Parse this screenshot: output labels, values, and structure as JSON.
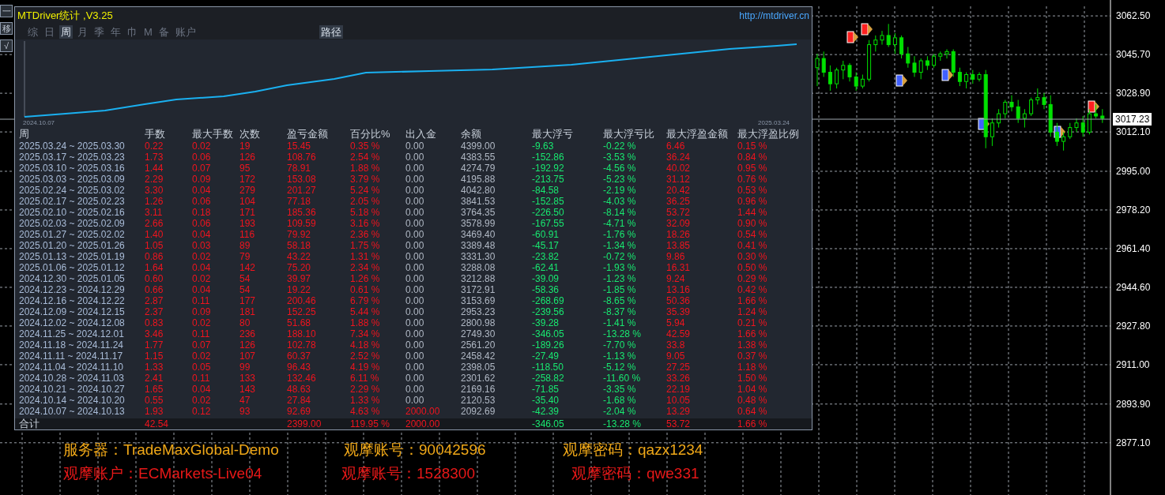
{
  "toolbar": [
    "一",
    "移",
    "√"
  ],
  "panel": {
    "title": "MTDriver统计 ,V3.25",
    "link": "http://mtdriver.cn",
    "tabs": [
      {
        "label": "综",
        "selected": false
      },
      {
        "label": "日",
        "selected": false
      },
      {
        "label": "周",
        "selected": true
      },
      {
        "label": "月",
        "selected": false
      },
      {
        "label": "季",
        "selected": false
      },
      {
        "label": "年",
        "selected": false
      },
      {
        "label": "巾",
        "selected": false
      },
      {
        "label": "M",
        "selected": false
      },
      {
        "label": "备",
        "selected": false
      },
      {
        "label": "账户",
        "selected": false
      }
    ],
    "path_button": "路径",
    "equity_chart": {
      "start_label": "2024.10.07",
      "end_label": "2025.03.24"
    },
    "table": {
      "columns": [
        {
          "label": "周",
          "kind": "date"
        },
        {
          "label": "手数",
          "kind": "red"
        },
        {
          "label": "最大手数",
          "kind": "red"
        },
        {
          "label": "次数",
          "kind": "red"
        },
        {
          "label": "盈亏金额",
          "kind": "red"
        },
        {
          "label": "百分比%",
          "kind": "red"
        },
        {
          "label": "出入金",
          "kind": "deposit"
        },
        {
          "label": "余额",
          "kind": "neutral"
        },
        {
          "label": "最大浮亏",
          "kind": "green"
        },
        {
          "label": "最大浮亏比",
          "kind": "green"
        },
        {
          "label": "最大浮盈金额",
          "kind": "red"
        },
        {
          "label": "最大浮盈比例",
          "kind": "red"
        }
      ],
      "rows": [
        {
          "flagged": false,
          "cells": [
            "2025.03.24 ~ 2025.03.30",
            "0.22",
            "0.02",
            "19",
            "15.45",
            "0.35 %",
            "0.00",
            "4399.00",
            "-9.63",
            "-0.22 %",
            "6.46",
            "0.15 %"
          ]
        },
        {
          "flagged": false,
          "cells": [
            "2025.03.17 ~ 2025.03.23",
            "1.73",
            "0.06",
            "126",
            "108.76",
            "2.54 %",
            "0.00",
            "4383.55",
            "-152.86",
            "-3.53 %",
            "36.24",
            "0.84 %"
          ]
        },
        {
          "flagged": false,
          "cells": [
            "2025.03.10 ~ 2025.03.16",
            "1.44",
            "0.07",
            "95",
            "78.91",
            "1.88 %",
            "0.00",
            "4274.79",
            "-192.92",
            "-4.56 %",
            "40.02",
            "0.95 %"
          ]
        },
        {
          "flagged": false,
          "cells": [
            "2025.03.03 ~ 2025.03.09",
            "2.29",
            "0.09",
            "172",
            "153.08",
            "3.79 %",
            "0.00",
            "4195.88",
            "-213.75",
            "-5.23 %",
            "31.12",
            "0.76 %"
          ]
        },
        {
          "flagged": false,
          "cells": [
            "2025.02.24 ~ 2025.03.02",
            "3.30",
            "0.04",
            "279",
            "201.27",
            "5.24 %",
            "0.00",
            "4042.80",
            "-84.58",
            "-2.19 %",
            "20.42",
            "0.53 %"
          ]
        },
        {
          "flagged": false,
          "cells": [
            "2025.02.17 ~ 2025.02.23",
            "1.26",
            "0.06",
            "104",
            "77.18",
            "2.05 %",
            "0.00",
            "3841.53",
            "-152.85",
            "-4.03 %",
            "36.25",
            "0.96 %"
          ]
        },
        {
          "flagged": false,
          "cells": [
            "2025.02.10 ~ 2025.02.16",
            "3.11",
            "0.18",
            "171",
            "185.36",
            "5.18 %",
            "0.00",
            "3764.35",
            "-226.50",
            "-8.14 %",
            "53.72",
            "1.44 %"
          ]
        },
        {
          "flagged": false,
          "cells": [
            "2025.02.03 ~ 2025.02.09",
            "2.66",
            "0.06",
            "193",
            "109.59",
            "3.16 %",
            "0.00",
            "3578.99",
            "-167.55",
            "-4.71 %",
            "32.09",
            "0.90 %"
          ]
        },
        {
          "flagged": false,
          "cells": [
            "2025.01.27 ~ 2025.02.02",
            "1.40",
            "0.04",
            "116",
            "79.92",
            "2.36 %",
            "0.00",
            "3469.40",
            "-60.91",
            "-1.76 %",
            "18.26",
            "0.54 %"
          ]
        },
        {
          "flagged": false,
          "cells": [
            "2025.01.20 ~ 2025.01.26",
            "1.05",
            "0.03",
            "89",
            "58.18",
            "1.75 %",
            "0.00",
            "3389.48",
            "-45.17",
            "-1.34 %",
            "13.85",
            "0.41 %"
          ]
        },
        {
          "flagged": false,
          "cells": [
            "2025.01.13 ~ 2025.01.19",
            "0.86",
            "0.02",
            "79",
            "43.22",
            "1.31 %",
            "0.00",
            "3331.30",
            "-23.82",
            "-0.72 %",
            "9.86",
            "0.30 %"
          ]
        },
        {
          "flagged": false,
          "cells": [
            "2025.01.06 ~ 2025.01.12",
            "1.64",
            "0.04",
            "142",
            "75.20",
            "2.34 %",
            "0.00",
            "3288.08",
            "-62.41",
            "-1.93 %",
            "16.31",
            "0.50 %"
          ]
        },
        {
          "flagged": false,
          "cells": [
            "2024.12.30 ~ 2025.01.05",
            "0.60",
            "0.02",
            "54",
            "39.97",
            "1.26 %",
            "0.00",
            "3212.88",
            "-39.09",
            "-1.23 %",
            "9.24",
            "0.29 %"
          ]
        },
        {
          "flagged": false,
          "cells": [
            "2024.12.23 ~ 2024.12.29",
            "0.66",
            "0.04",
            "54",
            "19.22",
            "0.61 %",
            "0.00",
            "3172.91",
            "-58.36",
            "-1.85 %",
            "13.16",
            "0.42 %"
          ]
        },
        {
          "flagged": false,
          "cells": [
            "2024.12.16 ~ 2024.12.22",
            "2.87",
            "0.11",
            "177",
            "200.46",
            "6.79 %",
            "0.00",
            "3153.69",
            "-268.69",
            "-8.65 %",
            "50.36",
            "1.66 %"
          ]
        },
        {
          "flagged": false,
          "cells": [
            "2024.12.09 ~ 2024.12.15",
            "2.37",
            "0.09",
            "181",
            "152.25",
            "5.44 %",
            "0.00",
            "2953.23",
            "-239.56",
            "-8.37 %",
            "35.39",
            "1.24 %"
          ]
        },
        {
          "flagged": false,
          "cells": [
            "2024.12.02 ~ 2024.12.08",
            "0.83",
            "0.02",
            "80",
            "51.68",
            "1.88 %",
            "0.00",
            "2800.98",
            "-39.28",
            "-1.41 %",
            "5.94",
            "0.21 %"
          ]
        },
        {
          "flagged": false,
          "cells": [
            "2024.11.25 ~ 2024.12.01",
            "3.46",
            "0.11",
            "236",
            "188.10",
            "7.34 %",
            "0.00",
            "2749.30",
            "-346.05",
            "-13.28 %",
            "42.59",
            "1.66 %"
          ]
        },
        {
          "flagged": false,
          "cells": [
            "2024.11.18 ~ 2024.11.24",
            "1.77",
            "0.07",
            "126",
            "102.78",
            "4.18 %",
            "0.00",
            "2561.20",
            "-189.26",
            "-7.70 %",
            "33.8",
            "1.38 %"
          ]
        },
        {
          "flagged": false,
          "cells": [
            "2024.11.11 ~ 2024.11.17",
            "1.15",
            "0.02",
            "107",
            "60.37",
            "2.52 %",
            "0.00",
            "2458.42",
            "-27.49",
            "-1.13 %",
            "9.05",
            "0.37 %"
          ]
        },
        {
          "flagged": false,
          "cells": [
            "2024.11.04 ~ 2024.11.10",
            "1.33",
            "0.05",
            "99",
            "96.43",
            "4.19 %",
            "0.00",
            "2398.05",
            "-118.50",
            "-5.12 %",
            "27.25",
            "1.18 %"
          ]
        },
        {
          "flagged": false,
          "cells": [
            "2024.10.28 ~ 2024.11.03",
            "2.41",
            "0.11",
            "133",
            "132.46",
            "6.11 %",
            "0.00",
            "2301.62",
            "-258.82",
            "-11.60 %",
            "33.26",
            "1.50 %"
          ]
        },
        {
          "flagged": false,
          "cells": [
            "2024.10.21 ~ 2024.10.27",
            "1.65",
            "0.04",
            "143",
            "48.63",
            "2.29 %",
            "0.00",
            "2169.16",
            "-71.85",
            "-3.35 %",
            "22.19",
            "1.04 %"
          ]
        },
        {
          "flagged": false,
          "cells": [
            "2024.10.14 ~ 2024.10.20",
            "0.55",
            "0.02",
            "47",
            "27.84",
            "1.33 %",
            "0.00",
            "2120.53",
            "-35.40",
            "-1.68 %",
            "10.05",
            "0.48 %"
          ]
        },
        {
          "flagged": true,
          "cells": [
            "2024.10.07 ~ 2024.10.13",
            "1.93",
            "0.12",
            "93",
            "92.69",
            "4.63 %",
            "2000.00",
            "2092.69",
            "-42.39",
            "-2.04 %",
            "13.29",
            "0.64 %"
          ]
        }
      ],
      "total": {
        "flagged": true,
        "cells": [
          "合计",
          "42.54",
          null,
          null,
          "2399.00",
          "119.95 %",
          "2000.00",
          null,
          "-346.05",
          "-13.28 %",
          "53.72",
          "1.66 %"
        ]
      }
    }
  },
  "price_chart": {
    "current_price": "3017.23",
    "chart_data": {
      "type": "candlestick",
      "grid": true,
      "ylim": [
        2854.4,
        3069.4
      ],
      "ohlc": [
        [
          3040,
          3046,
          3032,
          3044
        ],
        [
          3044,
          3047,
          3036,
          3038
        ],
        [
          3038,
          3041,
          3030,
          3033
        ],
        [
          3033,
          3040,
          3031,
          3039
        ],
        [
          3039,
          3043,
          3035,
          3041
        ],
        [
          3041,
          3042,
          3034,
          3036
        ],
        [
          3036,
          3038,
          3030,
          3032
        ],
        [
          3032,
          3037,
          3031,
          3035
        ],
        [
          3035,
          3052,
          3034,
          3050
        ],
        [
          3050,
          3054,
          3047,
          3052
        ],
        [
          3052,
          3056,
          3050,
          3054
        ],
        [
          3054,
          3059,
          3049,
          3050
        ],
        [
          3050,
          3055,
          3046,
          3053
        ],
        [
          3053,
          3054,
          3044,
          3046
        ],
        [
          3046,
          3049,
          3040,
          3042
        ],
        [
          3042,
          3045,
          3036,
          3038
        ],
        [
          3038,
          3044,
          3035,
          3043
        ],
        [
          3043,
          3045,
          3039,
          3041
        ],
        [
          3041,
          3046,
          3040,
          3045
        ],
        [
          3045,
          3047,
          3043,
          3046
        ],
        [
          3046,
          3048,
          3044,
          3047
        ],
        [
          3047,
          3048,
          3036,
          3038
        ],
        [
          3038,
          3040,
          3032,
          3034
        ],
        [
          3034,
          3038,
          3031,
          3037
        ],
        [
          3037,
          3039,
          3033,
          3035
        ],
        [
          3035,
          3038,
          3034,
          3037
        ],
        [
          3037,
          3039,
          3005,
          3010
        ],
        [
          3010,
          3018,
          3006,
          3016
        ],
        [
          3016,
          3022,
          3014,
          3020
        ],
        [
          3020,
          3026,
          3018,
          3025
        ],
        [
          3025,
          3028,
          3021,
          3023
        ],
        [
          3023,
          3026,
          3016,
          3018
        ],
        [
          3018,
          3022,
          3014,
          3020
        ],
        [
          3020,
          3027,
          3019,
          3026
        ],
        [
          3026,
          3031,
          3024,
          3027
        ],
        [
          3027,
          3029,
          3022,
          3024
        ],
        [
          3024,
          3028,
          3010,
          3012
        ],
        [
          3012,
          3016,
          3006,
          3008
        ],
        [
          3008,
          3012,
          3004,
          3010
        ],
        [
          3010,
          3016,
          3009,
          3014
        ],
        [
          3014,
          3018,
          3012,
          3016
        ],
        [
          3016,
          3019,
          3010,
          3012
        ],
        [
          3012,
          3022,
          3011,
          3020
        ],
        [
          3020,
          3024,
          3018,
          3019
        ],
        [
          3019,
          3022,
          3016,
          3018
        ]
      ],
      "yticks": [
        {
          "value": 3062.5,
          "label": "3062.50"
        },
        {
          "value": 3045.7,
          "label": "3045.70"
        },
        {
          "value": 3028.9,
          "label": "3028.90"
        },
        {
          "value": 3012.1,
          "label": "3012.10"
        },
        {
          "value": 2995,
          "label": "2995.00"
        },
        {
          "value": 2978.2,
          "label": "2978.20"
        },
        {
          "value": 2961.4,
          "label": "2961.40"
        },
        {
          "value": 2944.6,
          "label": "2944.60"
        },
        {
          "value": 2927.8,
          "label": "2927.80"
        },
        {
          "value": 2911,
          "label": "2911.00"
        },
        {
          "value": 2893.9,
          "label": "2893.90"
        },
        {
          "value": 2877.1,
          "label": "2877.10"
        }
      ]
    }
  },
  "overlay": [
    {
      "kind": "server",
      "items": [
        "服务器：TradeMaxGlobal-Demo",
        "观摩账号：90042596",
        "观摩密码：qazx1234"
      ]
    },
    {
      "kind": "account",
      "items": [
        "观摩账户：ECMarkets-Live04",
        "观摩账号：1528300",
        "观摩密码：qwe331"
      ]
    }
  ]
}
